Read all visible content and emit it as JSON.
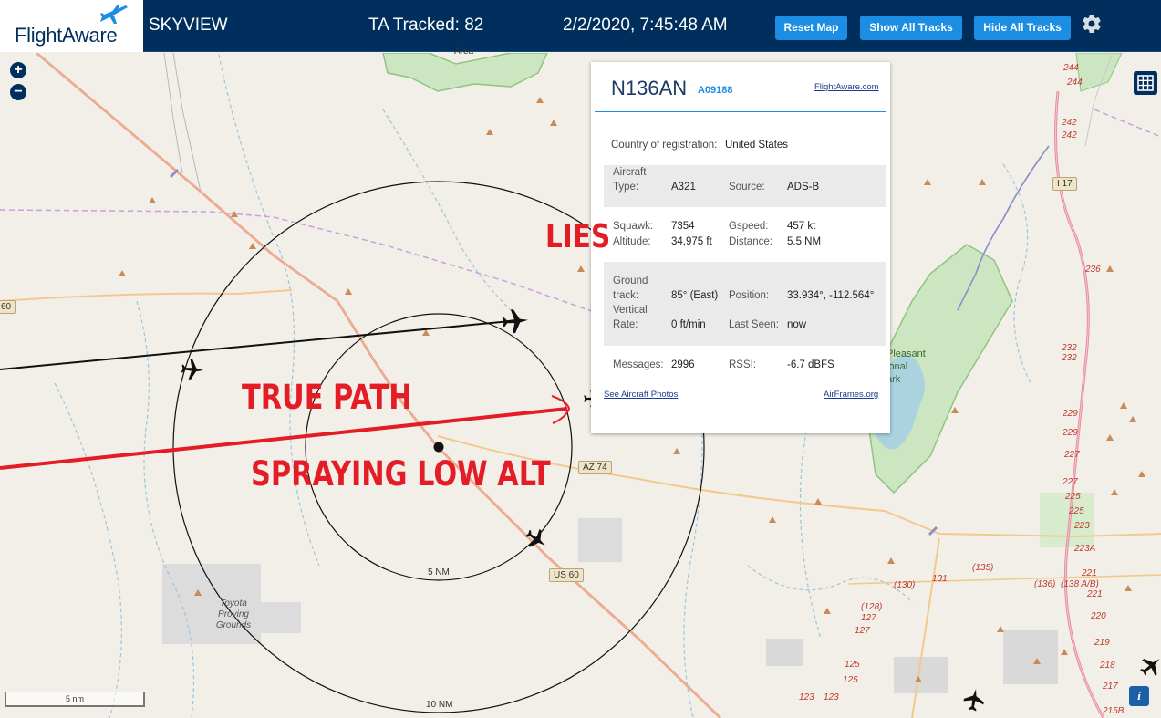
{
  "header": {
    "brand": "FlightAware",
    "app_title": "SKYVIEW",
    "tracked": "TA Tracked: 82",
    "datetime": "2/2/2020, 7:45:48 AM",
    "buttons": {
      "reset": "Reset Map",
      "show_all": "Show All Tracks",
      "hide_all": "Hide All Tracks"
    },
    "settings_icon": "gear-icon"
  },
  "map": {
    "zoom_in": "+",
    "zoom_out": "−",
    "scale_label": "5 nm",
    "ring_inner_label": "5 NM",
    "ring_outer_label": "10 NM",
    "place_labels": {
      "top_area": "Area",
      "proving_grounds": "Toyota Proving Grounds",
      "lake_park_1": "Pleasant",
      "lake_park_2": "ional",
      "lake_park_3": "ark"
    },
    "shields": {
      "az74": "AZ 74",
      "us60": "US 60",
      "left60": "60",
      "i17": "I 17"
    },
    "road_numbers": [
      "244",
      "244",
      "242",
      "242",
      "236",
      "232",
      "232",
      "229",
      "229",
      "227",
      "227",
      "225",
      "225",
      "223",
      "223A",
      "221",
      "221",
      "220",
      "219",
      "218",
      "217",
      "215B",
      "(135)",
      "(136)",
      "(138 A/B)",
      "131",
      "(130)",
      "(128)",
      "127",
      "127",
      "125",
      "125",
      "123",
      "123"
    ],
    "info_icon": "info-icon",
    "layers_icon": "grid-icon"
  },
  "aircraft": {
    "registration": "N136AN",
    "hex": "A09188",
    "fa_link": "FlightAware.com",
    "country_label": "Country of registration:",
    "country": "United States",
    "type_label_1": "Aircraft",
    "type_label_2": "Type:",
    "type": "A321",
    "source_label": "Source:",
    "source": "ADS-B",
    "squawk_label": "Squawk:",
    "squawk": "7354",
    "gspeed_label": "Gspeed:",
    "gspeed": "457 kt",
    "altitude_label": "Altitude:",
    "altitude": "34,975 ft",
    "distance_label": "Distance:",
    "distance": "5.5 NM",
    "track_label_1": "Ground",
    "track_label_2": "track:",
    "track": "85° (East)",
    "position_label": "Position:",
    "position": "33.934°, -112.564°",
    "vrate_label_1": "Vertical",
    "vrate_label_2": "Rate:",
    "vrate": "0 ft/min",
    "lastseen_label": "Last Seen:",
    "lastseen": "now",
    "messages_label": "Messages:",
    "messages": "2996",
    "rssi_label": "RSSI:",
    "rssi": "-6.7 dBFS",
    "photos_link": "See Aircraft Photos",
    "airframes_link": "AirFrames.org"
  },
  "annotations": {
    "lies": "LIES",
    "true_path": "TRUE PATH",
    "spraying": "SPRAYING LOW ALT",
    "color": "#e31c25"
  }
}
